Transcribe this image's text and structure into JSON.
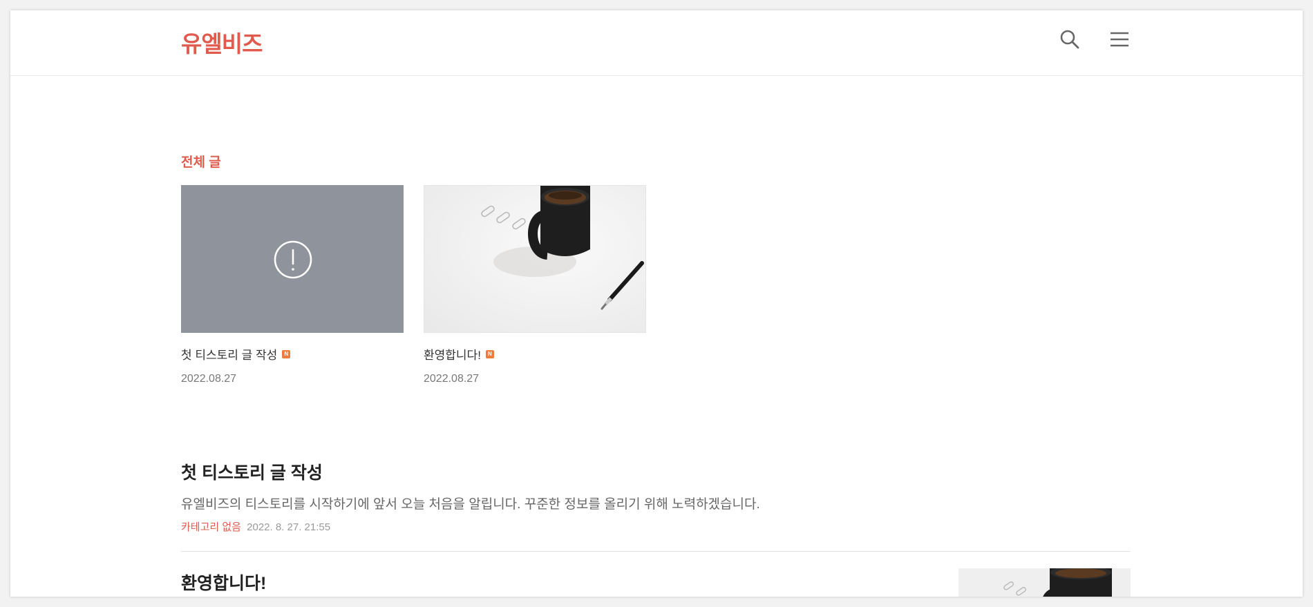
{
  "header": {
    "logo": "유엘비즈",
    "search_icon": "search-icon",
    "menu_icon": "menu-icon"
  },
  "section": {
    "title": "전체 글"
  },
  "cards": [
    {
      "title": "첫 티스토리 글 작성",
      "badge": "N",
      "date": "2022.08.27",
      "thumbnail": "error-placeholder"
    },
    {
      "title": "환영합니다!",
      "badge": "N",
      "date": "2022.08.27",
      "thumbnail": "coffee-mug-photo"
    }
  ],
  "posts": [
    {
      "title": "첫 티스토리 글 작성",
      "excerpt": "유엘비즈의 티스토리를 시작하기에 앞서 오늘 처음을 알립니다. 꾸준한 정보를 올리기 위해 노력하겠습니다.",
      "category": "카테고리 없음",
      "datetime": "2022. 8. 27. 21:55"
    },
    {
      "title": "환영합니다!"
    }
  ],
  "colors": {
    "accent": "#e05a4d",
    "placeholder": "#8f939c",
    "badge": "#ef7b3d"
  }
}
